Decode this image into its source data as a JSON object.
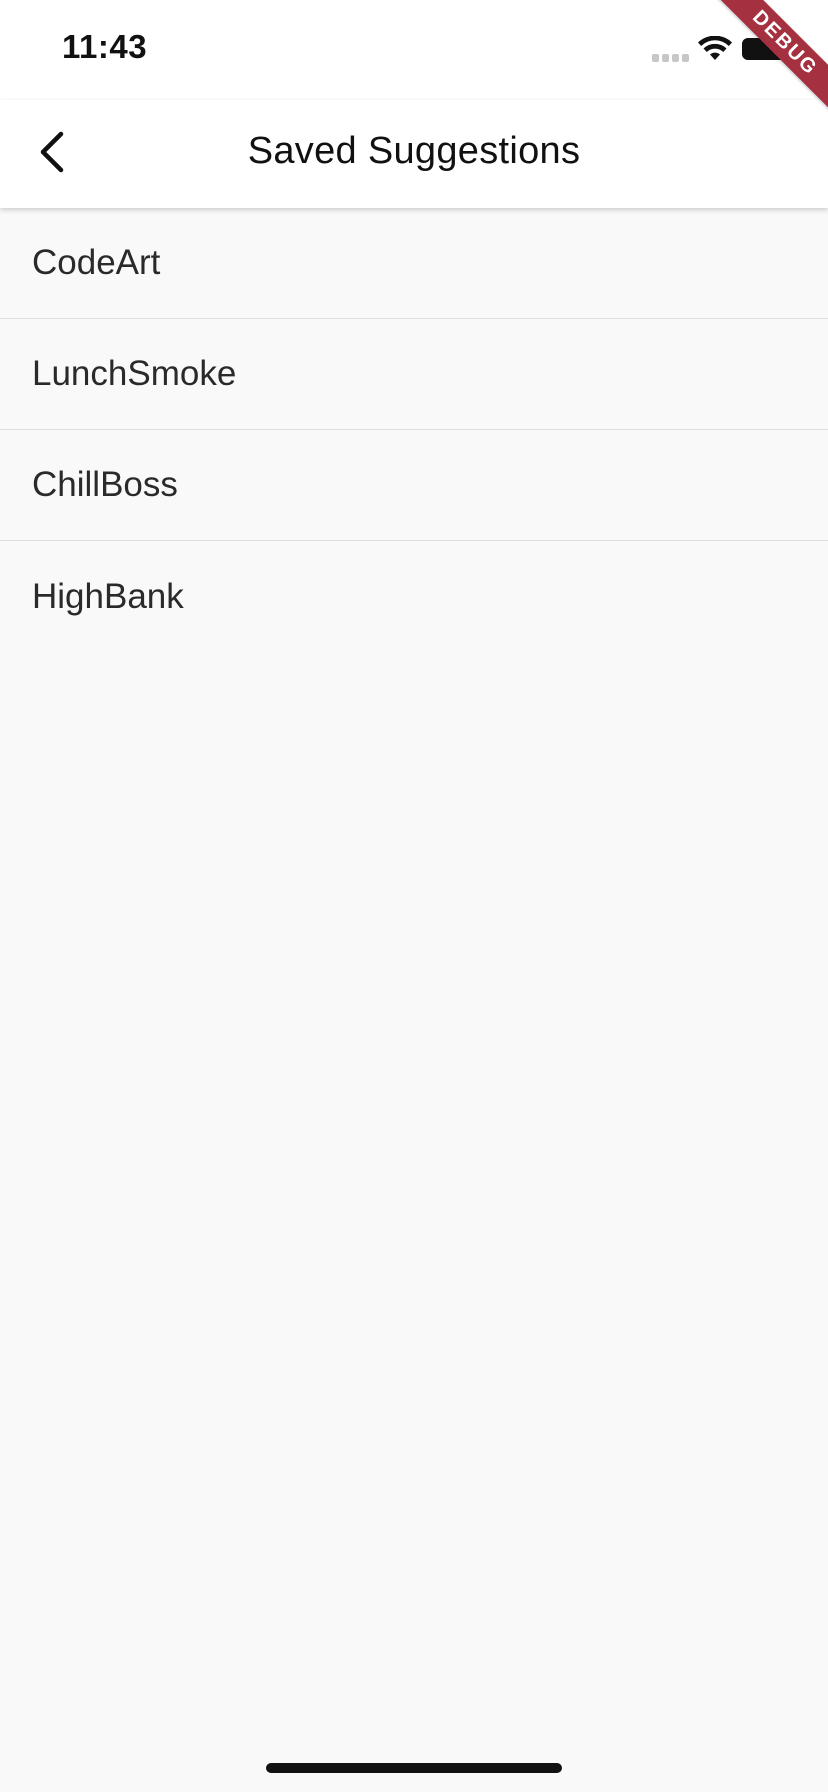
{
  "status_bar": {
    "time": "11:43"
  },
  "debug_banner": {
    "label": "DEBUG",
    "color": "#a5303f"
  },
  "app_bar": {
    "title": "Saved Suggestions",
    "back_icon": "chevron-left-icon"
  },
  "suggestions": [
    {
      "label": "CodeArt"
    },
    {
      "label": "LunchSmoke"
    },
    {
      "label": "ChillBoss"
    },
    {
      "label": "HighBank"
    }
  ],
  "colors": {
    "background": "#f9f9f9",
    "app_bar": "#ffffff",
    "divider": "#dedede"
  }
}
